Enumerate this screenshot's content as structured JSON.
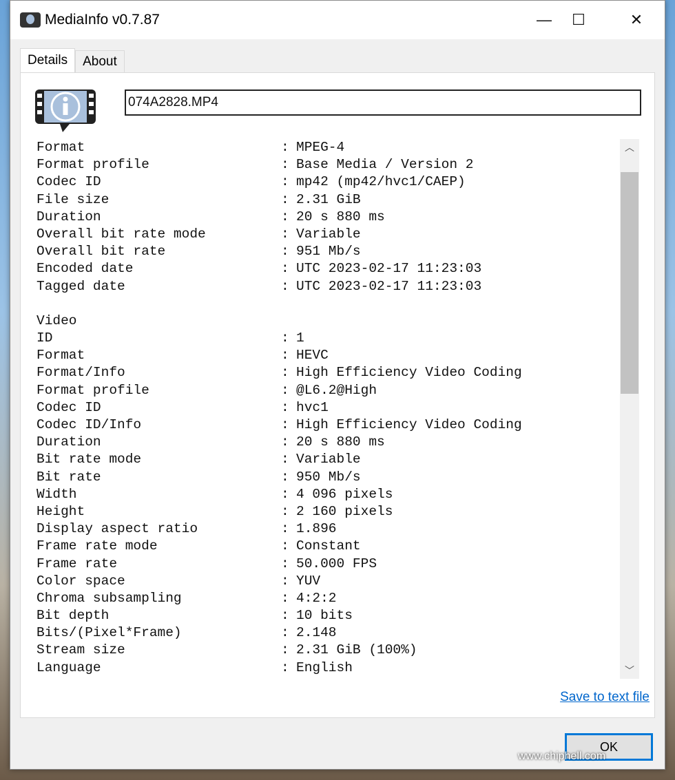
{
  "window": {
    "title": "MediaInfo v0.7.87",
    "minimize": "—",
    "maximize": "☐",
    "close": "✕"
  },
  "tabs": [
    {
      "label": "Details",
      "active": true
    },
    {
      "label": "About",
      "active": false
    }
  ],
  "file_name": "074A2828.MP4",
  "details": [
    {
      "label": "Format",
      "value": "MPEG-4"
    },
    {
      "label": "Format profile",
      "value": "Base Media / Version 2"
    },
    {
      "label": "Codec ID",
      "value": "mp42 (mp42/hvc1/CAEP)"
    },
    {
      "label": "File size",
      "value": "2.31 GiB"
    },
    {
      "label": "Duration",
      "value": "20 s 880 ms"
    },
    {
      "label": "Overall bit rate mode",
      "value": "Variable"
    },
    {
      "label": "Overall bit rate",
      "value": "951 Mb/s"
    },
    {
      "label": "Encoded date",
      "value": "UTC 2023-02-17 11:23:03"
    },
    {
      "label": "Tagged date",
      "value": "UTC 2023-02-17 11:23:03"
    },
    {
      "label": "",
      "value": ""
    },
    {
      "label": "Video",
      "value": ""
    },
    {
      "label": "ID",
      "value": "1"
    },
    {
      "label": "Format",
      "value": "HEVC"
    },
    {
      "label": "Format/Info",
      "value": "High Efficiency Video Coding"
    },
    {
      "label": "Format profile",
      "value": "@L6.2@High"
    },
    {
      "label": "Codec ID",
      "value": "hvc1"
    },
    {
      "label": "Codec ID/Info",
      "value": "High Efficiency Video Coding"
    },
    {
      "label": "Duration",
      "value": "20 s 880 ms"
    },
    {
      "label": "Bit rate mode",
      "value": "Variable"
    },
    {
      "label": "Bit rate",
      "value": "950 Mb/s"
    },
    {
      "label": "Width",
      "value": "4 096 pixels"
    },
    {
      "label": "Height",
      "value": "2 160 pixels"
    },
    {
      "label": "Display aspect ratio",
      "value": "1.896"
    },
    {
      "label": "Frame rate mode",
      "value": "Constant"
    },
    {
      "label": "Frame rate",
      "value": "50.000 FPS"
    },
    {
      "label": "Color space",
      "value": "YUV"
    },
    {
      "label": "Chroma subsampling",
      "value": "4:2:2"
    },
    {
      "label": "Bit depth",
      "value": "10 bits"
    },
    {
      "label": "Bits/(Pixel*Frame)",
      "value": "2.148"
    },
    {
      "label": "Stream size",
      "value": "2.31 GiB (100%)"
    },
    {
      "label": "Language",
      "value": "English"
    }
  ],
  "scrollbar": {
    "up": "︿",
    "down": "﹀"
  },
  "save_link": "Save to text file",
  "ok_button": "OK",
  "watermark": "www.chiphell.com"
}
